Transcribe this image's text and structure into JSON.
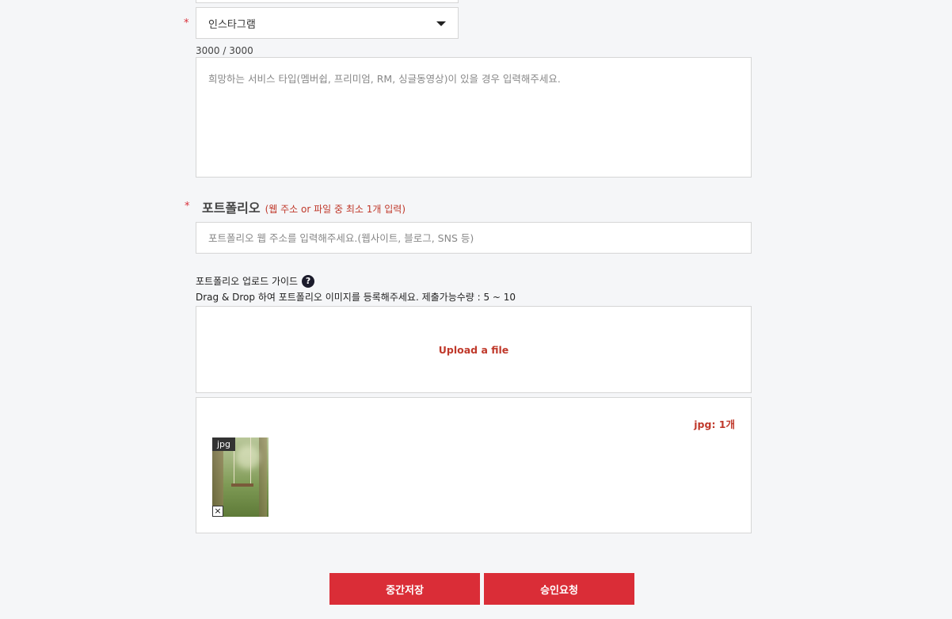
{
  "required_mark": "*",
  "sns_field": {
    "selected": "인스타그램",
    "counter": "3000 / 3000",
    "textarea_placeholder": "희망하는 서비스 타입(멤버쉽, 프리미엄, RM, 싱글동영상)이 있을 경우 입력해주세요."
  },
  "portfolio": {
    "title": "포트폴리오",
    "hint": "(웹 주소 or 파일 중 최소 1개 입력)",
    "url_placeholder": "포트폴리오 웹 주소를 입력해주세요.(웹사이트, 블로그, SNS 등)",
    "guide_title": "포트폴리오 업로드 가이드",
    "guide_help_symbol": "?",
    "guide_desc": "Drag & Drop 하여 포트폴리오 이미지를 등록해주세요. 제출가능수량 : 5 ~ 10",
    "upload_label": "Upload a file",
    "file_count": "jpg: 1개",
    "files": [
      {
        "type_badge": "jpg",
        "remove_symbol": "×"
      }
    ]
  },
  "buttons": {
    "save": "중간저장",
    "submit": "승인요청"
  },
  "colors": {
    "accent": "#da2d37",
    "hint_red": "#c0392b",
    "background": "#f5f6f8"
  }
}
